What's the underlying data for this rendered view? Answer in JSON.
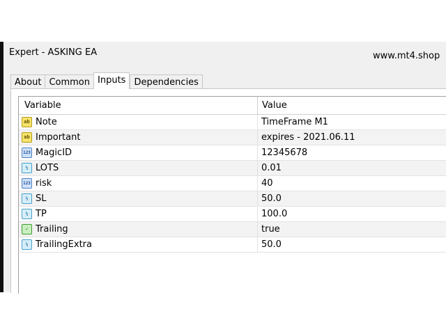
{
  "window": {
    "title": "Expert - ASKING EA",
    "site": "www.mt4.shop"
  },
  "tabs": [
    {
      "label": "About"
    },
    {
      "label": "Common"
    },
    {
      "label": "Inputs"
    },
    {
      "label": "Dependencies"
    }
  ],
  "active_tab": "Inputs",
  "table": {
    "headers": {
      "variable": "Variable",
      "value": "Value"
    },
    "rows": [
      {
        "icon": "text-ab-icon",
        "variable": "Note",
        "value": "TimeFrame M1"
      },
      {
        "icon": "text-ab-icon",
        "variable": "Important",
        "value": "expires - 2021.06.11"
      },
      {
        "icon": "integer-123-icon",
        "variable": "MagicID",
        "value": "12345678"
      },
      {
        "icon": "double-half-icon",
        "variable": "LOTS",
        "value": "0.01"
      },
      {
        "icon": "integer-123-icon",
        "variable": "risk",
        "value": "40"
      },
      {
        "icon": "double-half-icon",
        "variable": "SL",
        "value": "50.0"
      },
      {
        "icon": "double-half-icon",
        "variable": "TP",
        "value": "100.0"
      },
      {
        "icon": "boolean-check-icon",
        "variable": "Trailing",
        "value": "true"
      },
      {
        "icon": "double-half-icon",
        "variable": "TrailingExtra",
        "value": "50.0"
      }
    ]
  },
  "colors": {
    "window_bg": "#f0f0f0",
    "grid_border": "#a0a0a0",
    "alt_row": "#f3f3f3"
  }
}
